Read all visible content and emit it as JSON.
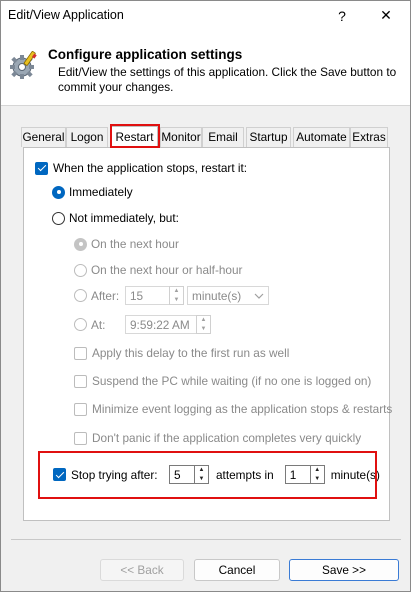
{
  "window": {
    "title": "Edit/View Application",
    "help_label": "?",
    "close_label": "✕"
  },
  "header": {
    "title": "Configure application settings",
    "description": "Edit/View the settings of this application. Click the Save button to commit your changes.",
    "icon": "gear-settings-icon"
  },
  "tabs": [
    "General",
    "Logon",
    "Restart",
    "Monitor",
    "Email",
    "Startup",
    "Automate",
    "Extras"
  ],
  "active_tab": "Restart",
  "restart": {
    "restart_on_stop": {
      "label": "When the application stops, restart it:",
      "checked": true
    },
    "immediately": {
      "label": "Immediately",
      "selected": true
    },
    "not_immediately": {
      "label": "Not immediately, but:",
      "selected": false
    },
    "next_hour": {
      "label": "On the next hour",
      "selected": true
    },
    "next_half_hour": {
      "label": "On the next hour or half-hour",
      "selected": false
    },
    "after": {
      "label": "After:",
      "value": "15",
      "unit": "minute(s)"
    },
    "at": {
      "label": "At:",
      "value": "9:59:22 AM"
    },
    "apply_delay_first": {
      "label": "Apply this delay to the first run as well",
      "checked": false
    },
    "suspend_pc": {
      "label": "Suspend the PC while waiting (if no one is logged on)",
      "checked": false
    },
    "minimize_logging": {
      "label": "Minimize event logging as the application stops & restarts",
      "checked": false
    },
    "dont_panic": {
      "label": "Don't panic if the application completes very quickly",
      "checked": false
    },
    "stop_trying": {
      "label": "Stop trying after:",
      "checked": true,
      "attempts_value": "5",
      "attempts_label": "attempts in",
      "minutes_value": "1",
      "minutes_label": "minute(s)"
    }
  },
  "buttons": {
    "back": "<< Back",
    "cancel": "Cancel",
    "save": "Save >>"
  },
  "colors": {
    "accent": "#0067c0",
    "highlight": "#e01010"
  }
}
